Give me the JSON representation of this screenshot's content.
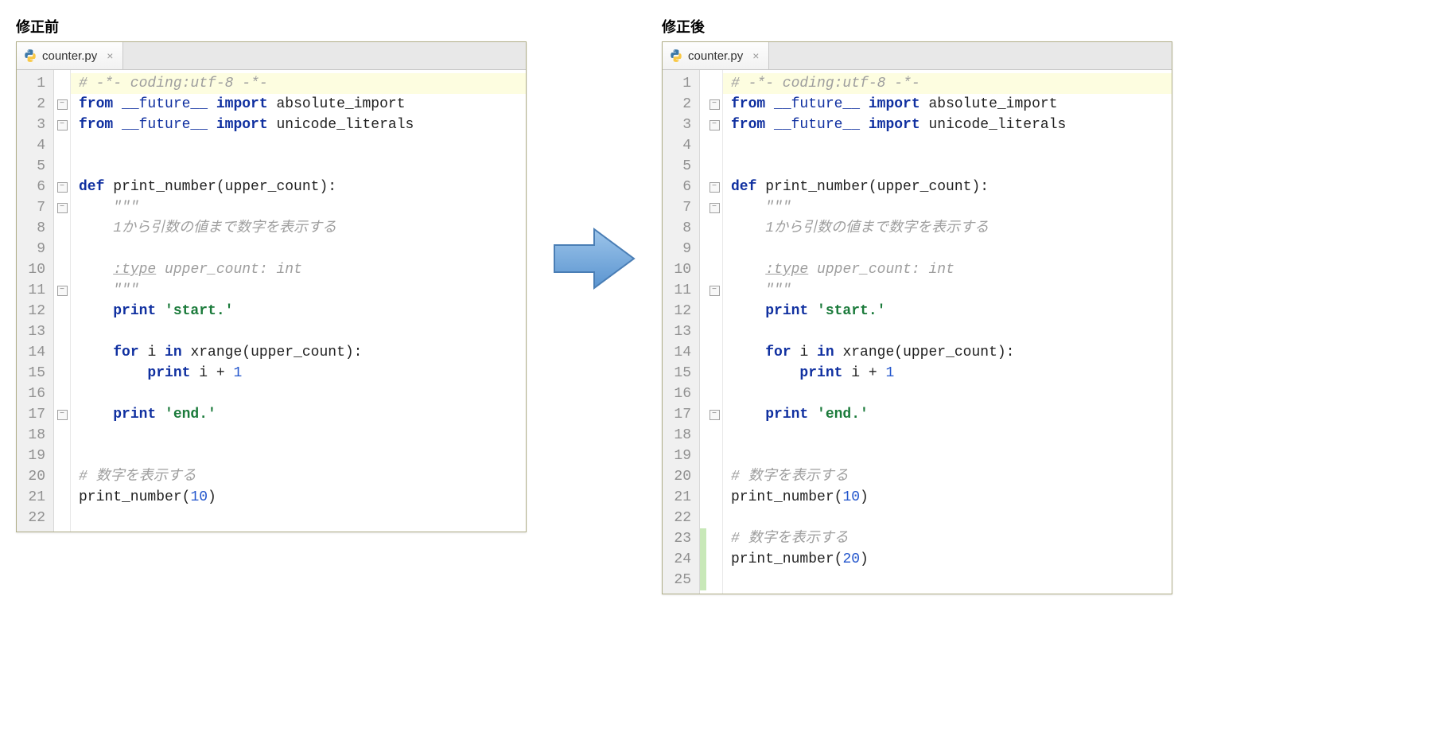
{
  "labels": {
    "before": "修正前",
    "after": "修正後"
  },
  "tab": {
    "filename": "counter.py",
    "close_glyph": "×"
  },
  "before": {
    "lines": [
      {
        "n": "1",
        "fold": "",
        "diff": "",
        "tok": [
          [
            "comment",
            "# -*- coding:utf-8 -*-"
          ]
        ],
        "hl": true
      },
      {
        "n": "2",
        "fold": "-",
        "diff": "",
        "tok": [
          [
            "kw",
            "from "
          ],
          [
            "builtin",
            "__future__"
          ],
          [
            "kw",
            " import "
          ],
          [
            "plain",
            "absolute_import"
          ]
        ]
      },
      {
        "n": "3",
        "fold": "-",
        "diff": "",
        "tok": [
          [
            "kw",
            "from "
          ],
          [
            "builtin",
            "__future__"
          ],
          [
            "kw",
            " import "
          ],
          [
            "plain",
            "unicode_literals"
          ]
        ]
      },
      {
        "n": "4",
        "fold": "",
        "diff": "",
        "tok": [
          [
            "plain",
            ""
          ]
        ]
      },
      {
        "n": "5",
        "fold": "",
        "diff": "",
        "tok": [
          [
            "plain",
            ""
          ]
        ]
      },
      {
        "n": "6",
        "fold": "-",
        "diff": "",
        "tok": [
          [
            "kw",
            "def "
          ],
          [
            "plain",
            "print_number(upper_count):"
          ]
        ]
      },
      {
        "n": "7",
        "fold": "-",
        "diff": "",
        "tok": [
          [
            "plain",
            "    "
          ],
          [
            "doc",
            "\"\"\""
          ]
        ]
      },
      {
        "n": "8",
        "fold": "",
        "diff": "",
        "tok": [
          [
            "plain",
            "    "
          ],
          [
            "doc",
            "1から引数の値まで数字を表示する"
          ]
        ]
      },
      {
        "n": "9",
        "fold": "",
        "diff": "",
        "tok": [
          [
            "plain",
            ""
          ]
        ]
      },
      {
        "n": "10",
        "fold": "",
        "diff": "",
        "tok": [
          [
            "plain",
            "    "
          ],
          [
            "doc-tag",
            ":type"
          ],
          [
            "doc",
            " upper_count: int"
          ]
        ]
      },
      {
        "n": "11",
        "fold": "-",
        "diff": "",
        "tok": [
          [
            "plain",
            "    "
          ],
          [
            "doc",
            "\"\"\""
          ]
        ]
      },
      {
        "n": "12",
        "fold": "",
        "diff": "",
        "tok": [
          [
            "plain",
            "    "
          ],
          [
            "kw",
            "print "
          ],
          [
            "str",
            "'start.'"
          ]
        ]
      },
      {
        "n": "13",
        "fold": "",
        "diff": "",
        "tok": [
          [
            "plain",
            ""
          ]
        ]
      },
      {
        "n": "14",
        "fold": "",
        "diff": "",
        "tok": [
          [
            "plain",
            "    "
          ],
          [
            "kw",
            "for "
          ],
          [
            "plain",
            "i "
          ],
          [
            "kw",
            "in "
          ],
          [
            "plain",
            "xrange(upper_count):"
          ]
        ]
      },
      {
        "n": "15",
        "fold": "",
        "diff": "",
        "tok": [
          [
            "plain",
            "        "
          ],
          [
            "kw",
            "print "
          ],
          [
            "plain",
            "i + "
          ],
          [
            "num",
            "1"
          ]
        ]
      },
      {
        "n": "16",
        "fold": "",
        "diff": "",
        "tok": [
          [
            "plain",
            ""
          ]
        ]
      },
      {
        "n": "17",
        "fold": "-",
        "diff": "",
        "tok": [
          [
            "plain",
            "    "
          ],
          [
            "kw",
            "print "
          ],
          [
            "str",
            "'end.'"
          ]
        ]
      },
      {
        "n": "18",
        "fold": "",
        "diff": "",
        "tok": [
          [
            "plain",
            ""
          ]
        ]
      },
      {
        "n": "19",
        "fold": "",
        "diff": "",
        "tok": [
          [
            "plain",
            ""
          ]
        ]
      },
      {
        "n": "20",
        "fold": "",
        "diff": "",
        "tok": [
          [
            "comment",
            "# 数字を表示する"
          ]
        ]
      },
      {
        "n": "21",
        "fold": "",
        "diff": "",
        "tok": [
          [
            "plain",
            "print_number("
          ],
          [
            "num",
            "10"
          ],
          [
            "plain",
            ")"
          ]
        ]
      },
      {
        "n": "22",
        "fold": "",
        "diff": "",
        "tok": [
          [
            "plain",
            ""
          ]
        ]
      }
    ]
  },
  "after": {
    "lines": [
      {
        "n": "1",
        "fold": "",
        "diff": "",
        "tok": [
          [
            "comment",
            "# -*- coding:utf-8 -*-"
          ]
        ],
        "hl": true
      },
      {
        "n": "2",
        "fold": "-",
        "diff": "",
        "tok": [
          [
            "kw",
            "from "
          ],
          [
            "builtin",
            "__future__"
          ],
          [
            "kw",
            " import "
          ],
          [
            "plain",
            "absolute_import"
          ]
        ]
      },
      {
        "n": "3",
        "fold": "-",
        "diff": "",
        "tok": [
          [
            "kw",
            "from "
          ],
          [
            "builtin",
            "__future__"
          ],
          [
            "kw",
            " import "
          ],
          [
            "plain",
            "unicode_literals"
          ]
        ]
      },
      {
        "n": "4",
        "fold": "",
        "diff": "",
        "tok": [
          [
            "plain",
            ""
          ]
        ]
      },
      {
        "n": "5",
        "fold": "",
        "diff": "",
        "tok": [
          [
            "plain",
            ""
          ]
        ]
      },
      {
        "n": "6",
        "fold": "-",
        "diff": "",
        "tok": [
          [
            "kw",
            "def "
          ],
          [
            "plain",
            "print_number(upper_count):"
          ]
        ]
      },
      {
        "n": "7",
        "fold": "-",
        "diff": "",
        "tok": [
          [
            "plain",
            "    "
          ],
          [
            "doc",
            "\"\"\""
          ]
        ]
      },
      {
        "n": "8",
        "fold": "",
        "diff": "",
        "tok": [
          [
            "plain",
            "    "
          ],
          [
            "doc",
            "1から引数の値まで数字を表示する"
          ]
        ]
      },
      {
        "n": "9",
        "fold": "",
        "diff": "",
        "tok": [
          [
            "plain",
            ""
          ]
        ]
      },
      {
        "n": "10",
        "fold": "",
        "diff": "",
        "tok": [
          [
            "plain",
            "    "
          ],
          [
            "doc-tag",
            ":type"
          ],
          [
            "doc",
            " upper_count: int"
          ]
        ]
      },
      {
        "n": "11",
        "fold": "-",
        "diff": "",
        "tok": [
          [
            "plain",
            "    "
          ],
          [
            "doc",
            "\"\"\""
          ]
        ]
      },
      {
        "n": "12",
        "fold": "",
        "diff": "",
        "tok": [
          [
            "plain",
            "    "
          ],
          [
            "kw",
            "print "
          ],
          [
            "str",
            "'start.'"
          ]
        ]
      },
      {
        "n": "13",
        "fold": "",
        "diff": "",
        "tok": [
          [
            "plain",
            ""
          ]
        ]
      },
      {
        "n": "14",
        "fold": "",
        "diff": "",
        "tok": [
          [
            "plain",
            "    "
          ],
          [
            "kw",
            "for "
          ],
          [
            "plain",
            "i "
          ],
          [
            "kw",
            "in "
          ],
          [
            "plain",
            "xrange(upper_count):"
          ]
        ]
      },
      {
        "n": "15",
        "fold": "",
        "diff": "",
        "tok": [
          [
            "plain",
            "        "
          ],
          [
            "kw",
            "print "
          ],
          [
            "plain",
            "i + "
          ],
          [
            "num",
            "1"
          ]
        ]
      },
      {
        "n": "16",
        "fold": "",
        "diff": "",
        "tok": [
          [
            "plain",
            ""
          ]
        ]
      },
      {
        "n": "17",
        "fold": "-",
        "diff": "",
        "tok": [
          [
            "plain",
            "    "
          ],
          [
            "kw",
            "print "
          ],
          [
            "str",
            "'end.'"
          ]
        ]
      },
      {
        "n": "18",
        "fold": "",
        "diff": "",
        "tok": [
          [
            "plain",
            ""
          ]
        ]
      },
      {
        "n": "19",
        "fold": "",
        "diff": "",
        "tok": [
          [
            "plain",
            ""
          ]
        ]
      },
      {
        "n": "20",
        "fold": "",
        "diff": "",
        "tok": [
          [
            "comment",
            "# 数字を表示する"
          ]
        ]
      },
      {
        "n": "21",
        "fold": "",
        "diff": "",
        "tok": [
          [
            "plain",
            "print_number("
          ],
          [
            "num",
            "10"
          ],
          [
            "plain",
            ")"
          ]
        ]
      },
      {
        "n": "22",
        "fold": "",
        "diff": "",
        "tok": [
          [
            "plain",
            ""
          ]
        ]
      },
      {
        "n": "23",
        "fold": "",
        "diff": "added",
        "tok": [
          [
            "comment",
            "# 数字を表示する"
          ]
        ]
      },
      {
        "n": "24",
        "fold": "",
        "diff": "added",
        "tok": [
          [
            "plain",
            "print_number("
          ],
          [
            "num",
            "20"
          ],
          [
            "plain",
            ")"
          ]
        ]
      },
      {
        "n": "25",
        "fold": "",
        "diff": "added",
        "tok": [
          [
            "plain",
            ""
          ]
        ]
      }
    ]
  }
}
